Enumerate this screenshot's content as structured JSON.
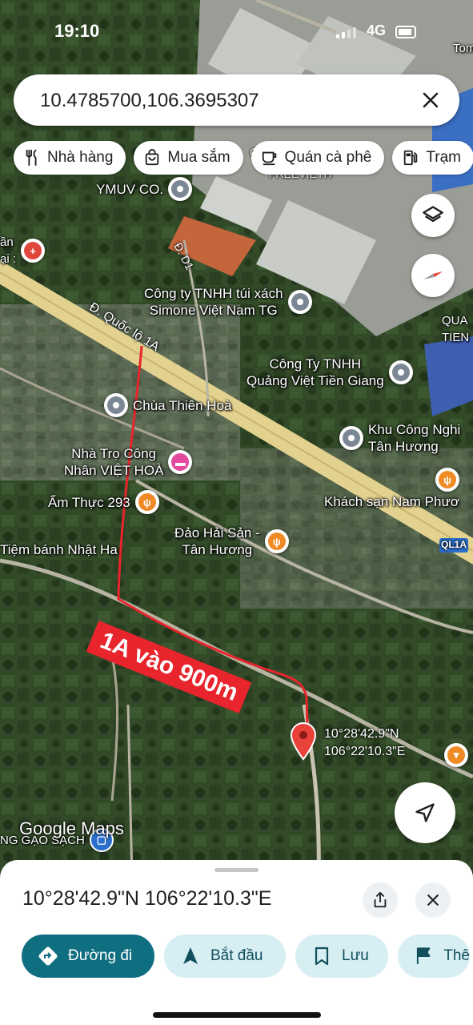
{
  "status_bar": {
    "time": "19:10",
    "network": "4G"
  },
  "search": {
    "query": "10.4785700,106.3695307"
  },
  "chips": [
    {
      "label": "Nhà hàng",
      "icon": "fork-knife-icon"
    },
    {
      "label": "Mua sắm",
      "icon": "shopping-bag-icon"
    },
    {
      "label": "Quán cà phê",
      "icon": "coffee-cup-icon"
    },
    {
      "label": "Trạm",
      "icon": "fuel-pump-icon"
    }
  ],
  "map": {
    "places": {
      "ymuv": "YMUV CO.",
      "left_top": "ần\nại :",
      "simone": "Công ty TNHH túi xách\nSimone Việt Nam TG",
      "quang_viet": "Công Ty TNHH\nQuảng Việt Tiền Giang",
      "chua": "Chùa Thiên Hoà",
      "khu_cn": "Khu Công Nghi\nTân Hương",
      "nha_tro": "Nhà Trọ Công\nNhân VIỆT HOÀ",
      "am_thuc": "Ẩm Thực 293",
      "khach_san": "Khách sạn Nam Phươ",
      "dao_hai_san": "Đảo Hải Sản -\nTân Hương",
      "tiem_banh": "Tiệm bánh Nhật Ha",
      "gao_sach": "NG GẠO SẠCH",
      "qua_tien": "QUA\nTIEN",
      "tom": "Tom",
      "free_vieth": "FREEVIETH",
      "co": "Cổ"
    },
    "roads": {
      "quoc_lo": "Đ. Quốc lộ 1A",
      "d1": "Đ. D1",
      "ql1a_badge": "QL1A"
    },
    "annotation": "1A vào 900m",
    "dropped_pin_label": "10°28'42.9\"N\n106°22'10.3\"E",
    "attribution": "Google Maps"
  },
  "sheet": {
    "title": "10°28'42.9\"N 106°22'10.3\"E",
    "actions": [
      {
        "label": "Đường đi",
        "icon": "directions-icon"
      },
      {
        "label": "Bắt đầu",
        "icon": "navigation-arrow-icon"
      },
      {
        "label": "Lưu",
        "icon": "bookmark-icon"
      },
      {
        "label": "Thê",
        "icon": "flag-icon"
      }
    ]
  },
  "colors": {
    "accent": "#0f6e7f",
    "annotation": "#e8242c",
    "road": "#e3d28f"
  }
}
